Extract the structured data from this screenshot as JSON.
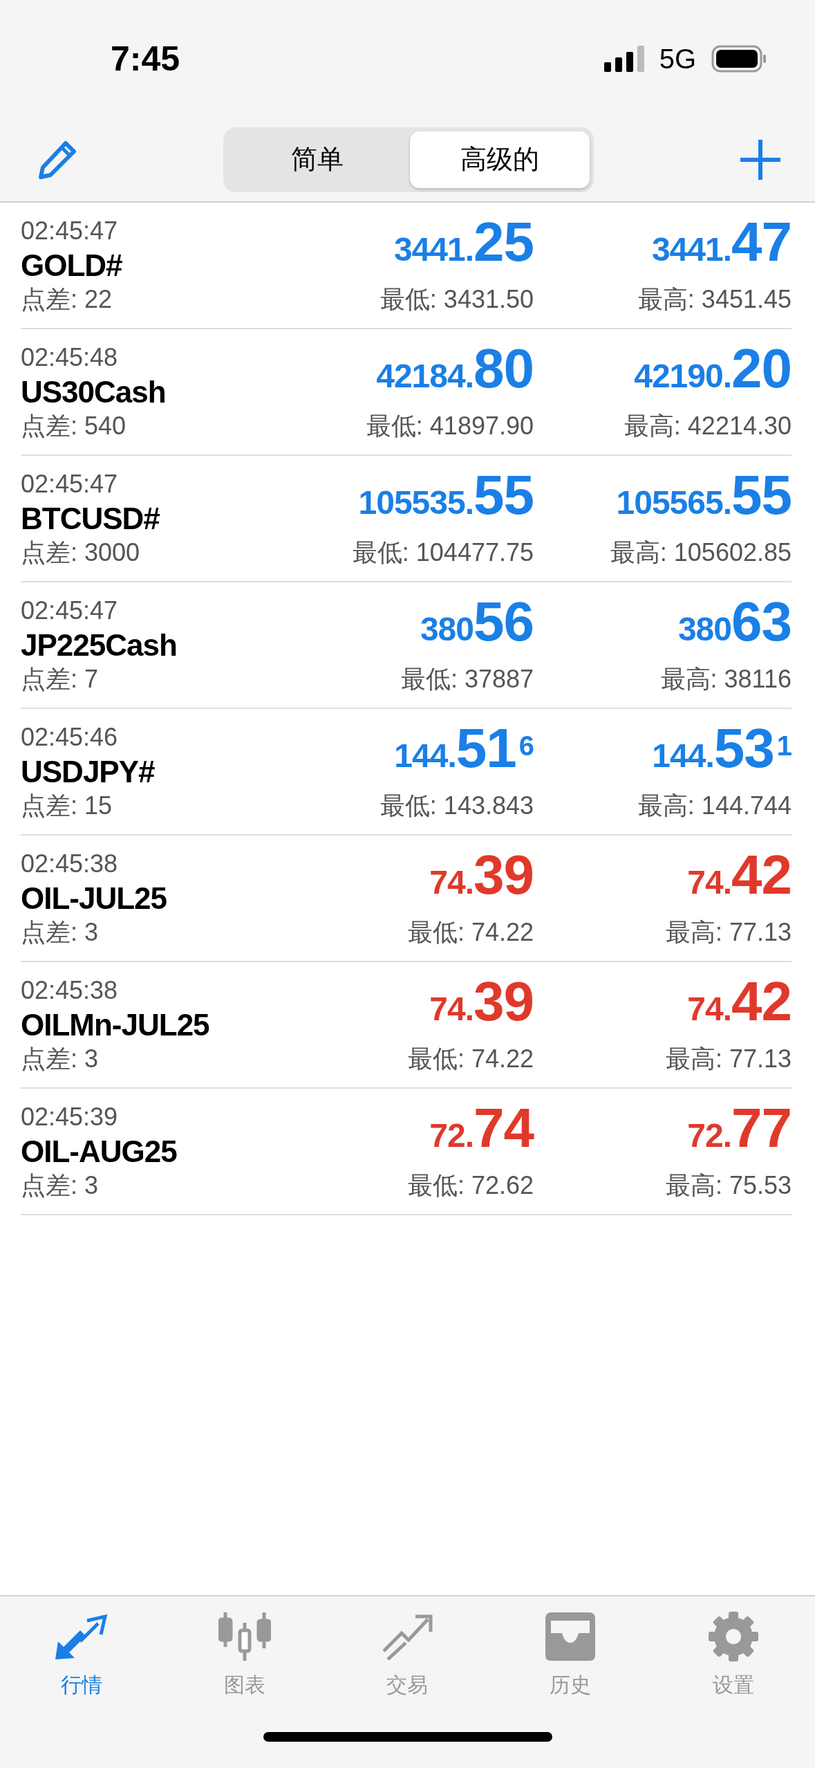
{
  "status_bar": {
    "time": "7:45",
    "network": "5G"
  },
  "toolbar": {
    "segments": [
      {
        "label": "简单",
        "selected": false
      },
      {
        "label": "高级的",
        "selected": true
      }
    ]
  },
  "quotes": [
    {
      "time": "02:45:47",
      "symbol": "GOLD#",
      "spread": "点差: 22",
      "color": "#1a7fe6",
      "bid": {
        "prefix": "3441.",
        "big": "25"
      },
      "ask": {
        "prefix": "3441.",
        "big": "47"
      },
      "low": "最低: 3431.50",
      "high": "最高: 3451.45"
    },
    {
      "time": "02:45:48",
      "symbol": "US30Cash",
      "spread": "点差: 540",
      "color": "#1a7fe6",
      "bid": {
        "prefix": "42184.",
        "big": "80"
      },
      "ask": {
        "prefix": "42190.",
        "big": "20"
      },
      "low": "最低: 41897.90",
      "high": "最高: 42214.30"
    },
    {
      "time": "02:45:47",
      "symbol": "BTCUSD#",
      "spread": "点差: 3000",
      "color": "#1a7fe6",
      "bid": {
        "prefix": "105535.",
        "big": "55"
      },
      "ask": {
        "prefix": "105565.",
        "big": "55"
      },
      "low": "最低: 104477.75",
      "high": "最高: 105602.85"
    },
    {
      "time": "02:45:47",
      "symbol": "JP225Cash",
      "spread": "点差: 7",
      "color": "#1a7fe6",
      "bid": {
        "prefix": "380",
        "big": "56"
      },
      "ask": {
        "prefix": "380",
        "big": "63"
      },
      "low": "最低: 37887",
      "high": "最高: 38116"
    },
    {
      "time": "02:45:46",
      "symbol": "USDJPY#",
      "spread": "点差: 15",
      "color": "#1a7fe6",
      "bid": {
        "prefix": "144.",
        "big": "51",
        "sup": "6"
      },
      "ask": {
        "prefix": "144.",
        "big": "53",
        "sup": "1"
      },
      "low": "最低: 143.843",
      "high": "最高: 144.744"
    },
    {
      "time": "02:45:38",
      "symbol": "OIL-JUL25",
      "spread": "点差: 3",
      "color": "#e0392b",
      "bid": {
        "prefix": "74.",
        "big": "39"
      },
      "ask": {
        "prefix": "74.",
        "big": "42"
      },
      "low": "最低: 74.22",
      "high": "最高: 77.13"
    },
    {
      "time": "02:45:38",
      "symbol": "OILMn-JUL25",
      "spread": "点差: 3",
      "color": "#e0392b",
      "bid": {
        "prefix": "74.",
        "big": "39"
      },
      "ask": {
        "prefix": "74.",
        "big": "42"
      },
      "low": "最低: 74.22",
      "high": "最高: 77.13"
    },
    {
      "time": "02:45:39",
      "symbol": "OIL-AUG25",
      "spread": "点差: 3",
      "color": "#e0392b",
      "bid": {
        "prefix": "72.",
        "big": "74"
      },
      "ask": {
        "prefix": "72.",
        "big": "77"
      },
      "low": "最低: 72.62",
      "high": "最高: 75.53"
    }
  ],
  "tab_bar": [
    {
      "label": "行情",
      "selected": true
    },
    {
      "label": "图表",
      "selected": false
    },
    {
      "label": "交易",
      "selected": false
    },
    {
      "label": "历史",
      "selected": false
    },
    {
      "label": "设置",
      "selected": false
    }
  ]
}
